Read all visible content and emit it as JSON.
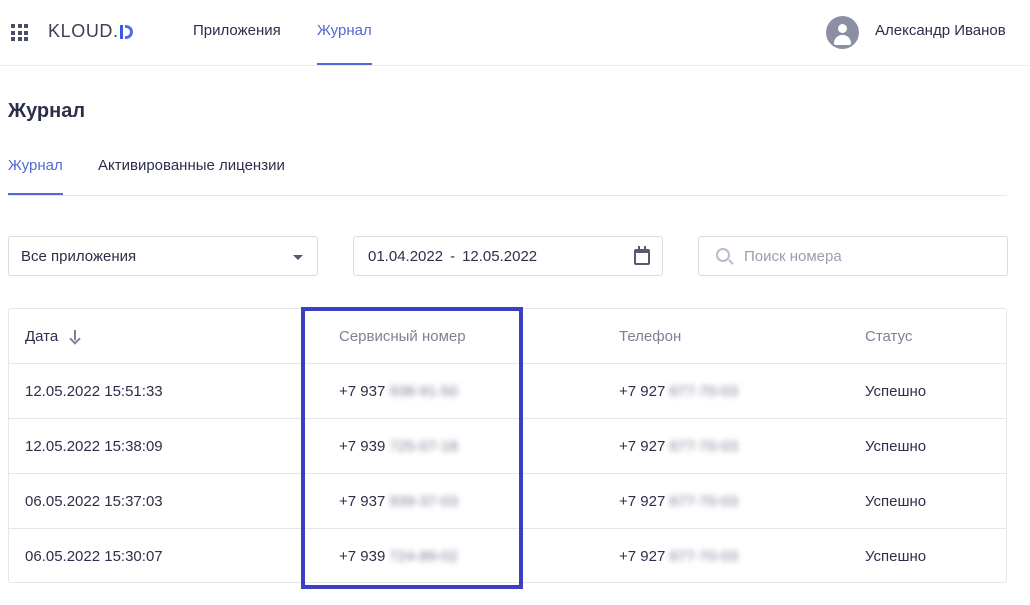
{
  "header": {
    "logo": "KLOUD.",
    "nav": [
      {
        "label": "Приложения",
        "active": false
      },
      {
        "label": "Журнал",
        "active": true
      }
    ],
    "user_name": "Александр Иванов",
    "accent_color": "#5468d4"
  },
  "page": {
    "title": "Журнал",
    "tabs": [
      {
        "label": "Журнал",
        "active": true
      },
      {
        "label": "Активированные лицензии",
        "active": false
      }
    ]
  },
  "filters": {
    "app_select": {
      "value": "Все приложения"
    },
    "date_range": {
      "from": "01.04.2022",
      "separator": "-",
      "to": "12.05.2022"
    },
    "search": {
      "placeholder": "Поиск номера",
      "value": ""
    }
  },
  "table": {
    "columns": [
      "Дата",
      "Сервисный номер",
      "Телефон",
      "Статус"
    ],
    "sorted_by": "Дата",
    "rows": [
      {
        "date": "12.05.2022 15:51:33",
        "service_prefix": "+7 937",
        "service_rest": "938-91-50",
        "phone_prefix": "+7 927",
        "phone_rest": "677-70-03",
        "status": "Успешно"
      },
      {
        "date": "12.05.2022 15:38:09",
        "service_prefix": "+7 939",
        "service_rest": "725-07-18",
        "phone_prefix": "+7 927",
        "phone_rest": "677-70-03",
        "status": "Успешно"
      },
      {
        "date": "06.05.2022 15:37:03",
        "service_prefix": "+7 937",
        "service_rest": "939-37-03",
        "phone_prefix": "+7 927",
        "phone_rest": "677-70-03",
        "status": "Успешно"
      },
      {
        "date": "06.05.2022 15:30:07",
        "service_prefix": "+7 939",
        "service_rest": "724-89-02",
        "phone_prefix": "+7 927",
        "phone_rest": "677-70-03",
        "status": "Успешно"
      }
    ]
  },
  "highlight_color": "#3c3fc2"
}
